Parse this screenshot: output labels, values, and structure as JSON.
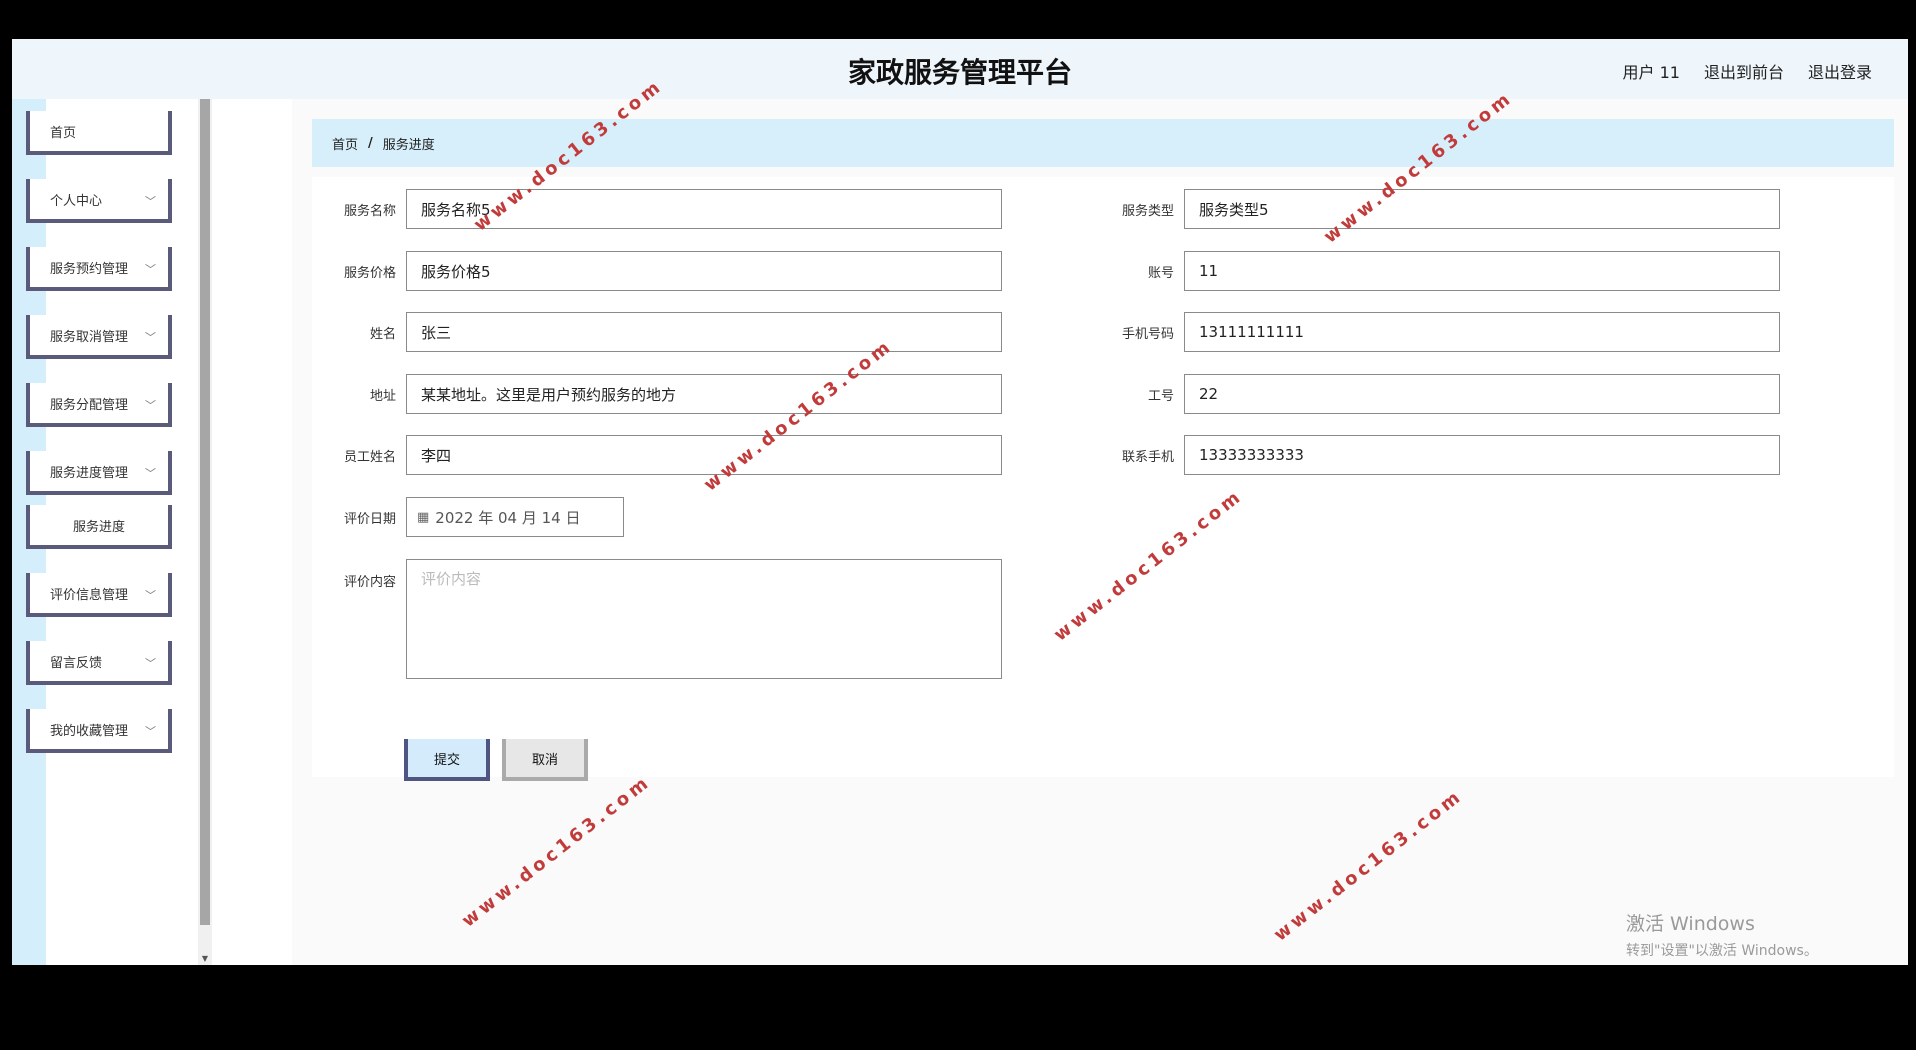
{
  "header": {
    "title": "家政服务管理平台",
    "user": "用户 11",
    "back_front": "退出到前台",
    "logout": "退出登录"
  },
  "sidebar": {
    "items": [
      {
        "label": "首页",
        "chevron": false
      },
      {
        "label": "个人中心",
        "chevron": true
      },
      {
        "label": "服务预约管理",
        "chevron": true
      },
      {
        "label": "服务取消管理",
        "chevron": true
      },
      {
        "label": "服务分配管理",
        "chevron": true
      },
      {
        "label": "服务进度管理",
        "chevron": true
      },
      {
        "label": "服务进度",
        "chevron": false,
        "sub": true
      },
      {
        "label": "评价信息管理",
        "chevron": true
      },
      {
        "label": "留言反馈",
        "chevron": true
      },
      {
        "label": "我的收藏管理",
        "chevron": true
      }
    ]
  },
  "breadcrumb": {
    "home": "首页",
    "current": "服务进度"
  },
  "form": {
    "service_name": {
      "label": "服务名称",
      "value": "服务名称5"
    },
    "service_type": {
      "label": "服务类型",
      "value": "服务类型5"
    },
    "service_price": {
      "label": "服务价格",
      "value": "服务价格5"
    },
    "account": {
      "label": "账号",
      "value": "11"
    },
    "name": {
      "label": "姓名",
      "value": "张三"
    },
    "phone": {
      "label": "手机号码",
      "value": "13111111111"
    },
    "address": {
      "label": "地址",
      "value": "某某地址。这里是用户预约服务的地方"
    },
    "job_no": {
      "label": "工号",
      "value": "22"
    },
    "staff_name": {
      "label": "员工姓名",
      "value": "李四"
    },
    "contact_phone": {
      "label": "联系手机",
      "value": "13333333333"
    },
    "eval_date": {
      "label": "评价日期",
      "value": "2022 年 04 月 14 日"
    },
    "eval_content": {
      "label": "评价内容",
      "placeholder": "评价内容"
    }
  },
  "buttons": {
    "submit": "提交",
    "cancel": "取消"
  },
  "windows": {
    "line1": "激活 Windows",
    "line2": "转到\"设置\"以激活 Windows。"
  },
  "watermark": "www.doc163.com"
}
